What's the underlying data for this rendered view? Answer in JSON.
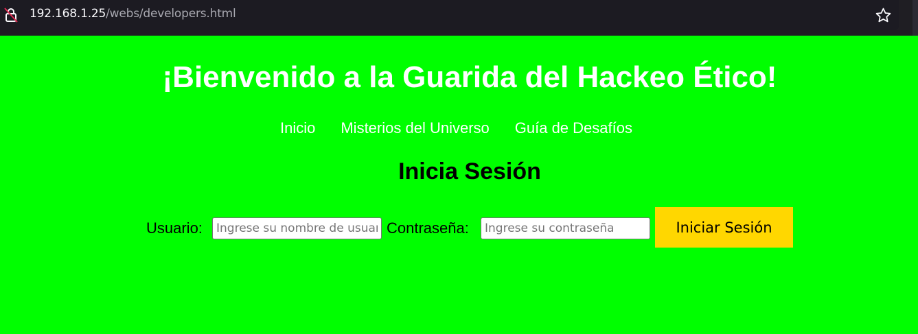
{
  "browser": {
    "url_host": "192.168.1.25",
    "url_path": "/webs/developers.html",
    "icons": {
      "site_info": "lock-slash-icon",
      "bookmark": "star-outline-icon"
    }
  },
  "page": {
    "background_color": "#00ff00",
    "title": "¡Bienvenido a la Guarida del Hackeo Ético!",
    "nav": [
      {
        "label": "Inicio"
      },
      {
        "label": "Misterios del Universo"
      },
      {
        "label": "Guía de Desafíos"
      }
    ],
    "login": {
      "heading": "Inicia Sesión",
      "username_label": "Usuario:",
      "username_placeholder": "Ingrese su nombre de usuario",
      "password_label": "Contraseña:",
      "password_placeholder": "Ingrese su contraseña",
      "submit_label": "Iniciar Sesión",
      "submit_color": "#ffd700"
    }
  }
}
